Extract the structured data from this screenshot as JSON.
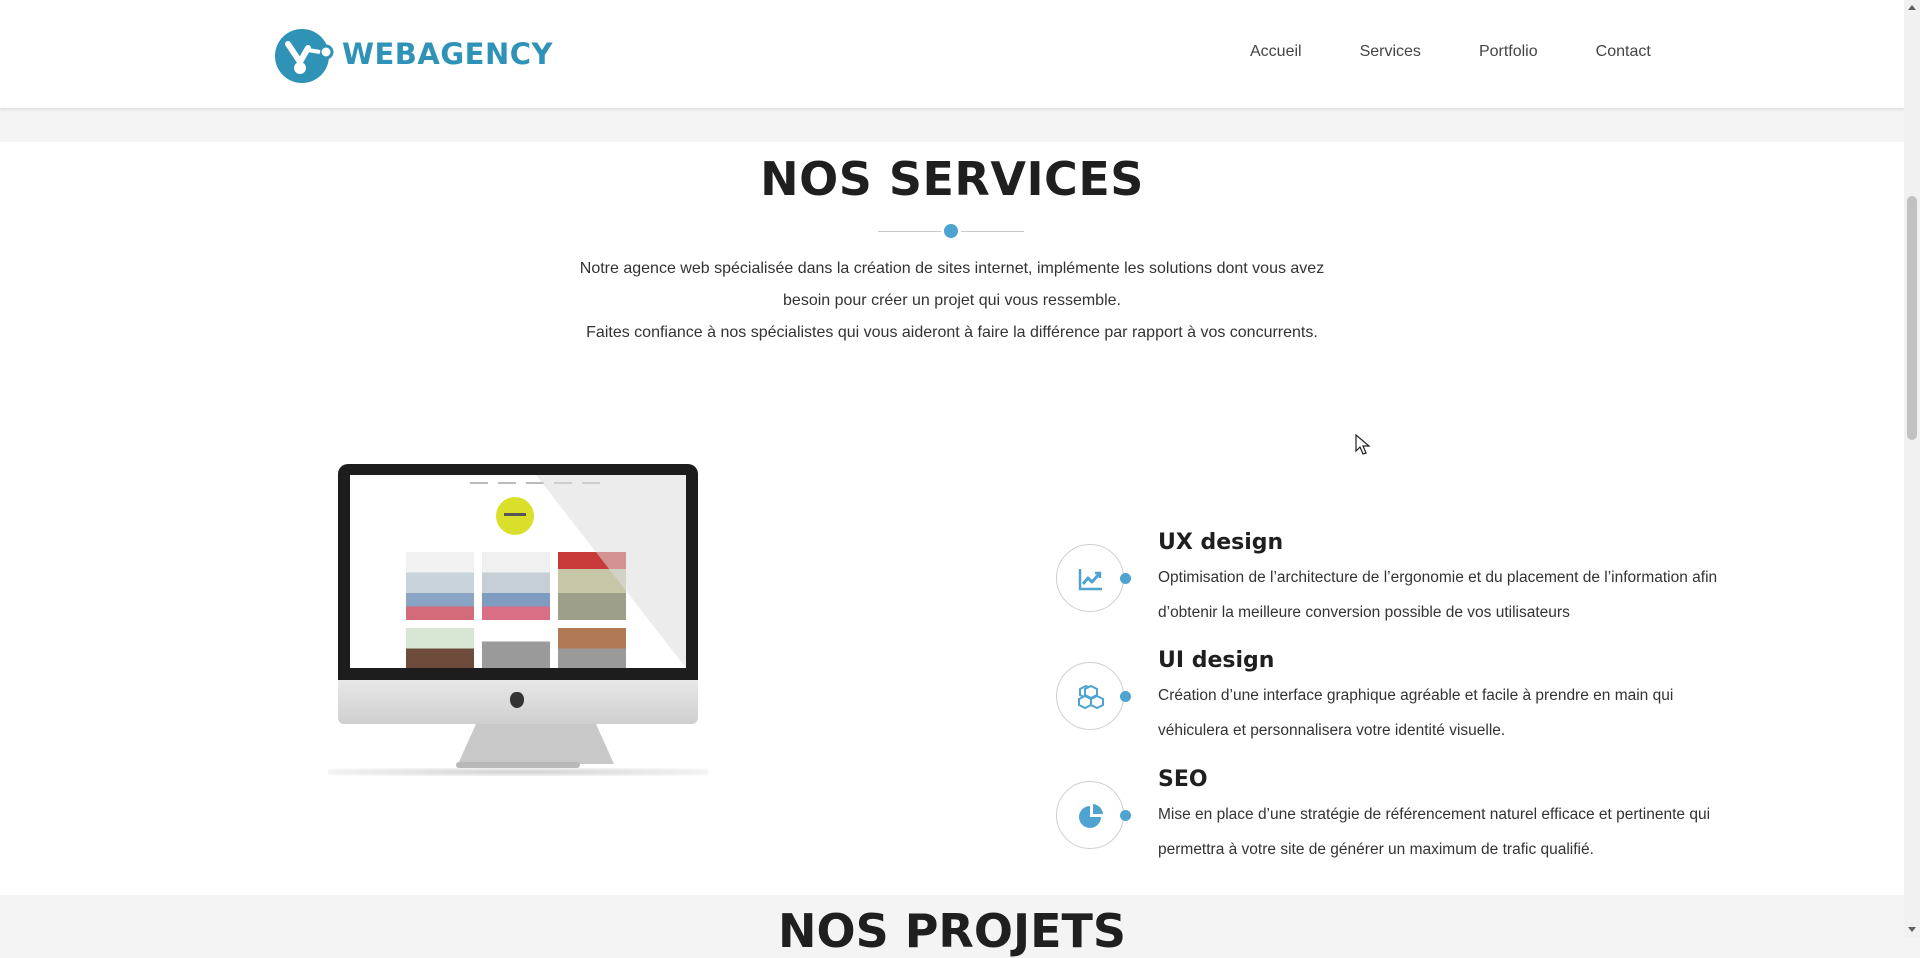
{
  "header": {
    "logo_text": "WEBAGENCY",
    "nav": [
      "Accueil",
      "Services",
      "Portfolio",
      "Contact"
    ]
  },
  "services_section": {
    "title": "NOS SERVICES",
    "intro_line1": "Notre agence web spécialisée dans la création de sites internet, implémente les solutions dont vous avez besoin pour créer un projet qui vous ressemble.",
    "intro_line2": "Faites confiance à nos spécialistes qui vous aideront à faire la différence par rapport à vos concurrents.",
    "items": [
      {
        "title": "UX design",
        "description": "Optimisation de l’architecture de l’ergonomie et du placement de l’information afin d’obtenir la meilleure conversion possible de vos utilisateurs",
        "icon": "chart-line-icon"
      },
      {
        "title": "UI design",
        "description": "Création d’une interface graphique agréable et facile à prendre en main qui véhiculera et personnalisera votre identité visuelle.",
        "icon": "cubes-icon"
      },
      {
        "title": "SEO",
        "description": "Mise en place d’une stratégie de référencement naturel efficace et pertinente qui permettra à votre site de générer un maximum de trafic qualifié.",
        "icon": "pie-chart-icon"
      }
    ]
  },
  "projects_section": {
    "title": "NOS PROJETS"
  },
  "colors": {
    "brand": "#2e93b6",
    "accent": "#4fa3d1",
    "heading": "#1f1f1f"
  }
}
